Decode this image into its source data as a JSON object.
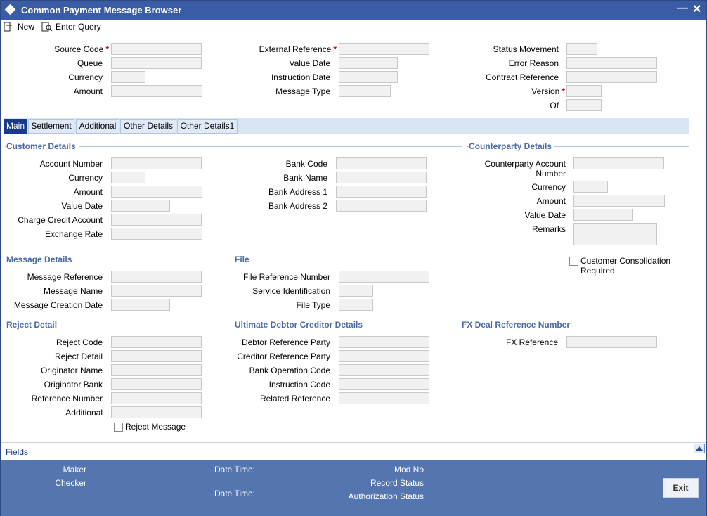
{
  "window": {
    "title": "Common Payment Message Browser",
    "minimize_glyph": "—",
    "close_glyph": "✕"
  },
  "toolbar": {
    "new_label": "New",
    "enter_query_label": "Enter Query"
  },
  "header_fields": {
    "source_code": "Source Code",
    "queue": "Queue",
    "currency": "Currency",
    "amount": "Amount",
    "external_reference": "External Reference",
    "value_date": "Value Date",
    "instruction_date": "Instruction Date",
    "message_type": "Message Type",
    "status_movement": "Status Movement",
    "error_reason": "Error Reason",
    "contract_reference": "Contract Reference",
    "version": "Version",
    "of": "Of",
    "required_mark": "*"
  },
  "tabs": [
    "Main",
    "Settlement",
    "Additional",
    "Other Details",
    "Other Details1"
  ],
  "customer_details": {
    "heading": "Customer Details",
    "account_number": "Account Number",
    "currency": "Currency",
    "amount": "Amount",
    "value_date": "Value Date",
    "charge_credit_account": "Charge Credit Account",
    "exchange_rate": "Exchange Rate",
    "bank_code": "Bank Code",
    "bank_name": "Bank Name",
    "bank_address_1": "Bank Address 1",
    "bank_address_2": "Bank Address 2"
  },
  "counterparty_details": {
    "heading": "Counterparty Details",
    "account_number": "Counterparty Account Number",
    "currency": "Currency",
    "amount": "Amount",
    "value_date": "Value Date",
    "remarks": "Remarks",
    "consolidation": "Customer Consolidation Required"
  },
  "message_details": {
    "heading": "Message Details",
    "message_reference": "Message Reference",
    "message_name": "Message Name",
    "message_creation_date": "Message Creation Date"
  },
  "file": {
    "heading": "File",
    "file_reference_number": "File Reference Number",
    "service_identification": "Service Identification",
    "file_type": "File Type"
  },
  "reject_detail": {
    "heading": "Reject Detail",
    "reject_code": "Reject Code",
    "reject_detail": "Reject Detail",
    "originator_name": "Originator Name",
    "originator_bank": "Originator Bank",
    "reference_number": "Reference Number",
    "additional": "Additional",
    "reject_message": "Reject Message"
  },
  "ultimate": {
    "heading": "Ultimate Debtor Creditor Details",
    "debtor_reference_party": "Debtor Reference Party",
    "creditor_reference_party": "Creditor Reference Party",
    "bank_operation_code": "Bank Operation Code",
    "instruction_code": "Instruction Code",
    "related_reference": "Related Reference"
  },
  "fx": {
    "heading": "FX Deal Reference Number",
    "fx_reference": "FX Reference"
  },
  "fields_bar": {
    "label": "Fields"
  },
  "footer": {
    "maker": "Maker",
    "checker": "Checker",
    "date_time": "Date Time:",
    "mod_no": "Mod No",
    "record_status": "Record Status",
    "authorization_status": "Authorization Status",
    "exit": "Exit"
  }
}
